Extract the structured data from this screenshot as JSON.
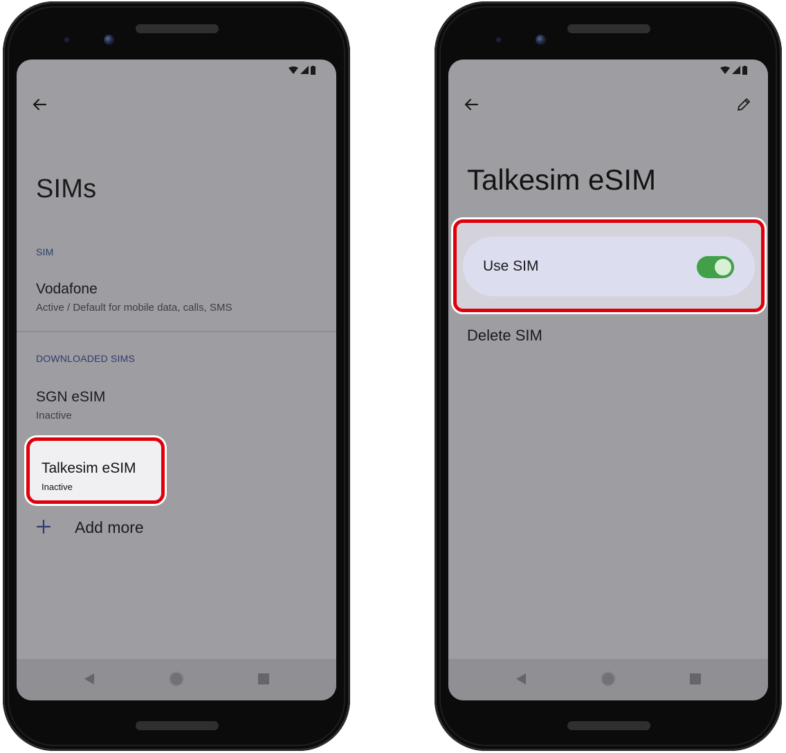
{
  "left_screen": {
    "title": "SIMs",
    "sim_section": {
      "header": "SIM",
      "items": [
        {
          "name": "Vodafone",
          "status": "Active / Default for mobile data, calls, SMS"
        }
      ]
    },
    "downloaded_section": {
      "header": "DOWNLOADED SIMS",
      "items": [
        {
          "name": "SGN eSIM",
          "status": "Inactive"
        },
        {
          "name": "Talkesim eSIM",
          "status": "Inactive",
          "highlighted": true
        }
      ]
    },
    "add_more_label": "Add more"
  },
  "right_screen": {
    "title": "Talkesim eSIM",
    "use_sim": {
      "label": "Use SIM",
      "enabled": true
    },
    "delete_label": "Delete SIM"
  },
  "icons": {
    "back": "back-arrow-icon",
    "edit": "pencil-icon",
    "add": "plus-icon",
    "status": [
      "wifi-icon",
      "signal-icon",
      "battery-icon"
    ],
    "nav": [
      "nav-back-icon",
      "nav-home-icon",
      "nav-recents-icon"
    ]
  },
  "colors": {
    "highlight_border": "#e0000b",
    "toggle_on": "#41a048",
    "section_header": "#2e3c6d",
    "screen_bg": "#9e9da2"
  }
}
